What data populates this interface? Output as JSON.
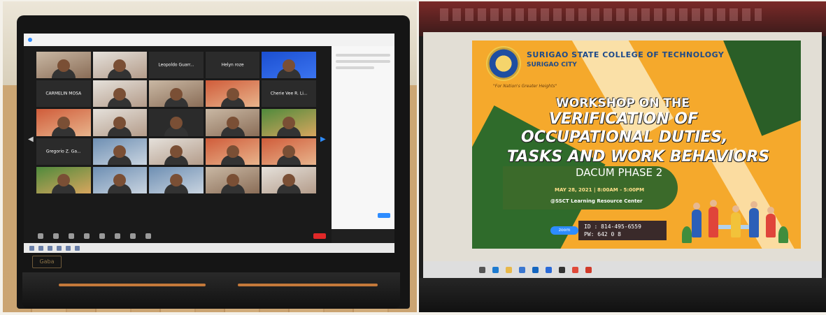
{
  "left_photo": {
    "brand": "Gaba",
    "participants": [
      {
        "name": "",
        "style": "cam"
      },
      {
        "name": "",
        "style": "cam2"
      },
      {
        "name": "Leopoldo Guarr...",
        "style": ""
      },
      {
        "name": "Helyn roze",
        "style": ""
      },
      {
        "name": "",
        "style": "blue"
      },
      {
        "name": "CARMELIN MOSA",
        "style": ""
      },
      {
        "name": "",
        "style": "cam2"
      },
      {
        "name": "",
        "style": "cam"
      },
      {
        "name": "",
        "style": "cam4"
      },
      {
        "name": "Cherie Vee R. Li...",
        "style": ""
      },
      {
        "name": "",
        "style": "cam4"
      },
      {
        "name": "",
        "style": "cam2"
      },
      {
        "name": "",
        "style": ""
      },
      {
        "name": "",
        "style": "cam"
      },
      {
        "name": "",
        "style": "cam5"
      },
      {
        "name": "Gregorio Z. Ga...",
        "style": ""
      },
      {
        "name": "",
        "style": "cam3"
      },
      {
        "name": "",
        "style": "cam2"
      },
      {
        "name": "",
        "style": "cam4"
      },
      {
        "name": "",
        "style": "cam4"
      },
      {
        "name": "",
        "style": "cam5"
      },
      {
        "name": "",
        "style": "cam3"
      },
      {
        "name": "",
        "style": "cam3"
      },
      {
        "name": "",
        "style": "cam"
      },
      {
        "name": "",
        "style": "cam2"
      }
    ]
  },
  "right_photo": {
    "slide": {
      "university_line1": "SURIGAO STATE COLLEGE OF TECHNOLOGY",
      "university_line2": "SURIGAO CITY",
      "tagline": "\"For Nation's Greater Heights\"",
      "title_line1": "WORKSHOP ON THE",
      "title_line2": "VERIFICATION OF",
      "title_line3": "OCCUPATIONAL DUTIES,",
      "title_line4": "TASKS AND WORK BEHAVIORS",
      "title_line5": "DACUM PHASE 2",
      "date": "MAY 28, 2021 | 8:00AM - 5:00PM",
      "venue": "@SSCT Learning Resource Center",
      "meeting_id": "ID : 814-495-6559",
      "passcode": "PW: 642 0 8",
      "zoom_label": "zoom"
    },
    "colors": {
      "slide_orange": "#f5a92c",
      "slide_green": "#2f6b2b",
      "title_white": "#ffffff"
    }
  }
}
